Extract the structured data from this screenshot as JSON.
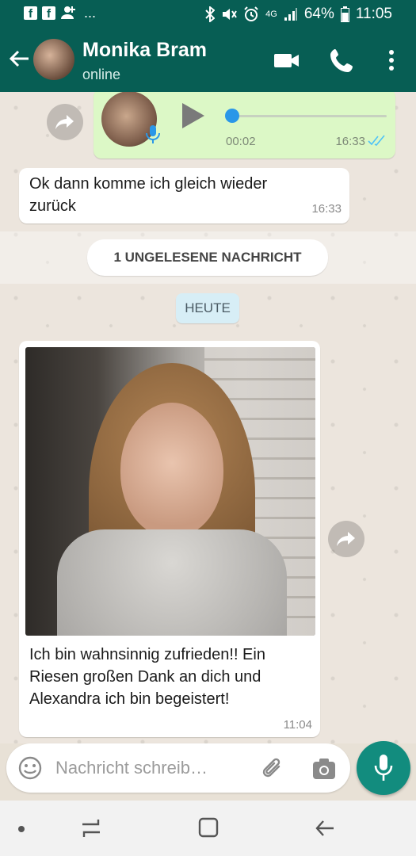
{
  "status_bar": {
    "notification_icons": [
      "facebook-icon",
      "facebook-icon",
      "add-person-icon"
    ],
    "more": "...",
    "network": "4G",
    "battery": "64%",
    "time": "11:05"
  },
  "header": {
    "contact_name": "Monika Bram",
    "status": "online"
  },
  "messages": {
    "voice": {
      "duration": "00:02",
      "time": "16:33",
      "progress": 0.0
    },
    "text1": {
      "line1": "Ok dann komme ich gleich wieder",
      "line2": "zurück",
      "time": "16:33"
    },
    "unread_banner": "1 UNGELESENE NACHRICHT",
    "date_label": "HEUTE",
    "photo_msg": {
      "line1": "Ich bin wahnsinnig zufrieden!!  Ein",
      "line2": "Riesen großen Dank an dich und",
      "line3": "Alexandra ich bin begeistert!",
      "time": "11:04"
    }
  },
  "composer": {
    "placeholder": "Nachricht schreib…"
  },
  "colors": {
    "primary": "#075e54",
    "accent": "#128c7e",
    "outgoing_bubble": "#dcf8c6",
    "incoming_bubble": "#ffffff",
    "read_ticks": "#4fc3f7"
  }
}
